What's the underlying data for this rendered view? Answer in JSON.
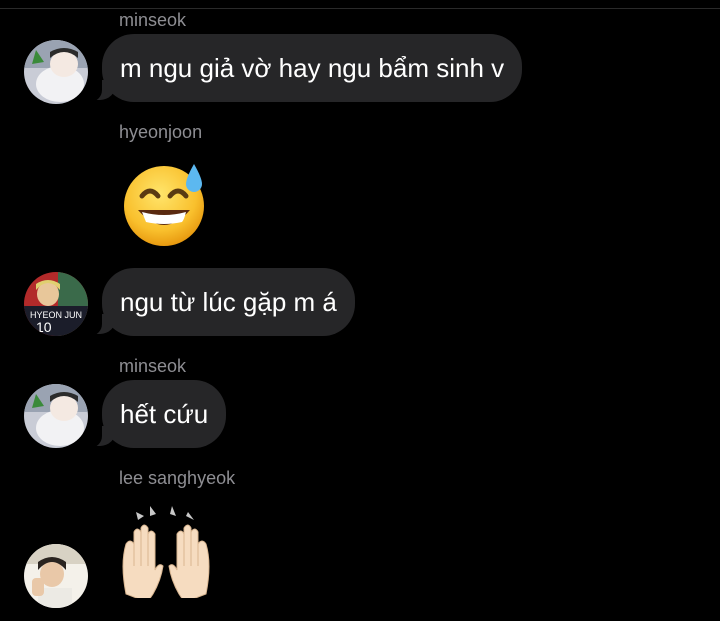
{
  "messages": [
    {
      "sender": "minseok",
      "text": "m ngu giả vờ hay ngu bẩm sinh v"
    },
    {
      "sender": "hyeonjoon",
      "emoji": "grinning-face-with-sweat-emoji"
    },
    {
      "text": "ngu từ lúc gặp m á"
    },
    {
      "sender": "minseok",
      "text": "hết cứu"
    },
    {
      "sender": "lee sanghyeok",
      "emoji": "raising-hands-emoji"
    }
  ],
  "avatars": {
    "a1": "minseok-avatar",
    "a2": "hyeonjoon-avatar",
    "a3": "minseok-avatar",
    "a4": "lee-sanghyeok-avatar"
  },
  "colors": {
    "background": "#000000",
    "bubble": "#262628",
    "sender": "#8e8e93"
  }
}
